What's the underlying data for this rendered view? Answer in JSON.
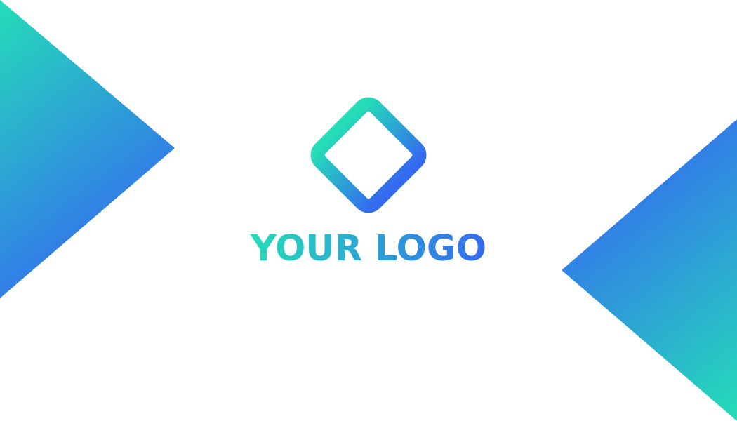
{
  "logo": {
    "text": "YOUR LOGO",
    "icon": "rounded-diamond-outline-icon"
  },
  "colors": {
    "background": "#ffffff",
    "gradient_start": "#25DDB8",
    "gradient_end": "#346BF0"
  }
}
